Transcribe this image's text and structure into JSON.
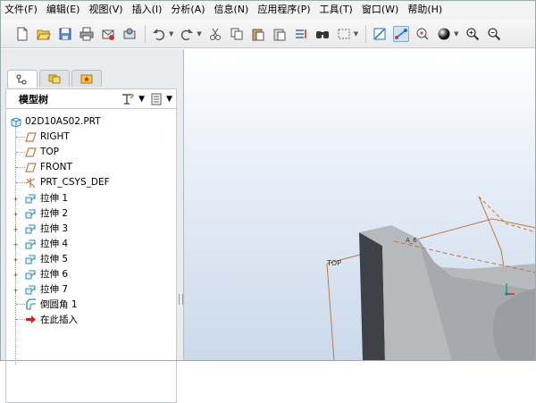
{
  "menu": [
    "文件(F)",
    "编辑(E)",
    "视图(V)",
    "插入(I)",
    "分析(A)",
    "信息(N)",
    "应用程序(P)",
    "工具(T)",
    "窗口(W)",
    "帮助(H)"
  ],
  "toolbar": {
    "icons": [
      "new-icon",
      "open-icon",
      "save-icon",
      "print-icon",
      "email-icon",
      "send-icon",
      "undo-icon",
      "redo-icon",
      "cut-icon",
      "copy-icon",
      "paste-icon",
      "paste-special-icon",
      "regenerate-icon",
      "find-icon",
      "select-box-icon",
      "datum-plane-toggle-icon",
      "datum-axis-toggle-icon",
      "datum-point-toggle-icon",
      "shading-icon",
      "zoom-in-icon",
      "zoom-out-icon"
    ]
  },
  "model_tree": {
    "title": "模型树",
    "items": [
      {
        "label": "02D10AS02.PRT",
        "icon": "part-icon",
        "expandable": false
      },
      {
        "label": "RIGHT",
        "icon": "datum-plane-icon",
        "expandable": false
      },
      {
        "label": "TOP",
        "icon": "datum-plane-icon",
        "expandable": false
      },
      {
        "label": "FRONT",
        "icon": "datum-plane-icon",
        "expandable": false
      },
      {
        "label": "PRT_CSYS_DEF",
        "icon": "csys-icon",
        "expandable": false
      },
      {
        "label": "拉伸 1",
        "icon": "extrude-icon",
        "expandable": true
      },
      {
        "label": "拉伸 2",
        "icon": "extrude-icon",
        "expandable": true
      },
      {
        "label": "拉伸 3",
        "icon": "extrude-icon",
        "expandable": true
      },
      {
        "label": "拉伸 4",
        "icon": "extrude-icon",
        "expandable": true
      },
      {
        "label": "拉伸 5",
        "icon": "extrude-icon",
        "expandable": true
      },
      {
        "label": "拉伸 6",
        "icon": "extrude-icon",
        "expandable": true
      },
      {
        "label": "拉伸 7",
        "icon": "extrude-icon",
        "expandable": true
      },
      {
        "label": "倒圆角 1",
        "icon": "round-icon",
        "expandable": false
      },
      {
        "label": "在此插入",
        "icon": "insert-here-icon",
        "expandable": false
      }
    ]
  },
  "viewport": {
    "top_label": "TOP",
    "axis_label": "A_6"
  },
  "colors": {
    "accent": "#1f6fbf",
    "datum": "#c07a3a",
    "insert_arrow": "#d21f1f",
    "model_dark": "#3e4248",
    "model_light": "#b7babd"
  }
}
